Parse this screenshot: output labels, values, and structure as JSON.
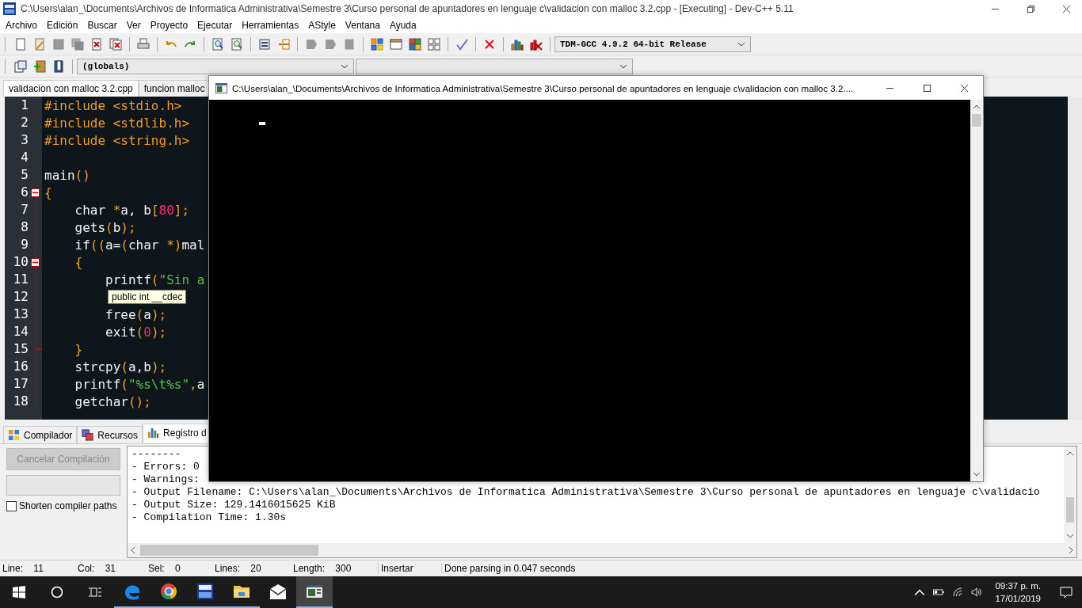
{
  "window": {
    "title": "C:\\Users\\alan_\\Documents\\Archivos de Informatica Administrativa\\Semestre 3\\Curso personal de apuntadores en lenguaje c\\validacion con malloc 3.2.cpp - [Executing] - Dev-C++ 5.11"
  },
  "menu": [
    "Archivo",
    "Edición",
    "Buscar",
    "Ver",
    "Proyecto",
    "Ejecutar",
    "Herramientas",
    "AStyle",
    "Ventana",
    "Ayuda"
  ],
  "compiler": {
    "value": "TDM-GCC 4.9.2 64-bit Release"
  },
  "scope": {
    "value": "(globals)"
  },
  "editor_tabs": [
    {
      "label": "validacion con malloc 3.2.cpp",
      "selected": true
    },
    {
      "label": "funcion malloc",
      "selected": false
    }
  ],
  "code": [
    {
      "n": "1",
      "kind": "plain",
      "tokens": [
        {
          "kind": "pre",
          "t": "#include <stdio.h>"
        }
      ]
    },
    {
      "n": "2",
      "kind": "plain",
      "tokens": [
        {
          "kind": "pre",
          "t": "#include <stdlib.h>"
        }
      ]
    },
    {
      "n": "3",
      "kind": "plain",
      "tokens": [
        {
          "kind": "pre",
          "t": "#include <string.h>"
        }
      ]
    },
    {
      "n": "4",
      "kind": "plain"
    },
    {
      "n": "5",
      "kind": "plain",
      "tokens": [
        {
          "kind": "id",
          "t": "main"
        },
        {
          "kind": "sym",
          "t": "()"
        }
      ]
    },
    {
      "n": "6",
      "kind": "fold_start",
      "tokens": [
        {
          "kind": "sym",
          "t": "{"
        }
      ]
    },
    {
      "n": "7",
      "kind": "plain",
      "tokens": [
        {
          "kind": "id",
          "t": "    char "
        },
        {
          "kind": "sym",
          "t": "*"
        },
        {
          "kind": "id",
          "t": "a, b"
        },
        {
          "kind": "sym",
          "t": "["
        },
        {
          "kind": "num",
          "t": "80"
        },
        {
          "kind": "sym",
          "t": "];"
        }
      ]
    },
    {
      "n": "8",
      "kind": "plain",
      "tokens": [
        {
          "kind": "id",
          "t": "    gets"
        },
        {
          "kind": "sym",
          "t": "("
        },
        {
          "kind": "id",
          "t": "b"
        },
        {
          "kind": "sym",
          "t": ");"
        }
      ]
    },
    {
      "n": "9",
      "kind": "plain",
      "tokens": [
        {
          "kind": "id",
          "t": "    if"
        },
        {
          "kind": "sym",
          "t": "(("
        },
        {
          "kind": "id",
          "t": "a="
        },
        {
          "kind": "sym",
          "t": "("
        },
        {
          "kind": "id",
          "t": "char "
        },
        {
          "kind": "sym",
          "t": "*)"
        },
        {
          "kind": "id",
          "t": "mal"
        }
      ]
    },
    {
      "n": "10",
      "kind": "fold_start",
      "tokens": [
        {
          "kind": "sym",
          "t": "    {"
        }
      ]
    },
    {
      "n": "11",
      "kind": "plain",
      "tokens": [
        {
          "kind": "id",
          "t": "        printf"
        },
        {
          "kind": "sym",
          "t": "("
        },
        {
          "kind": "str",
          "t": "\"Sin a"
        }
      ]
    },
    {
      "n": "12",
      "kind": "plain"
    },
    {
      "n": "13",
      "kind": "plain",
      "tokens": [
        {
          "kind": "id",
          "t": "        free"
        },
        {
          "kind": "sym",
          "t": "("
        },
        {
          "kind": "id",
          "t": "a"
        },
        {
          "kind": "sym",
          "t": ");"
        }
      ]
    },
    {
      "n": "14",
      "kind": "plain",
      "tokens": [
        {
          "kind": "id",
          "t": "        exit"
        },
        {
          "kind": "sym",
          "t": "("
        },
        {
          "kind": "num",
          "t": "0"
        },
        {
          "kind": "sym",
          "t": ");"
        }
      ]
    },
    {
      "n": "15",
      "kind": "fold_end",
      "tokens": [
        {
          "kind": "sym",
          "t": "    }"
        }
      ]
    },
    {
      "n": "16",
      "kind": "plain",
      "tokens": [
        {
          "kind": "id",
          "t": "    strcpy"
        },
        {
          "kind": "sym",
          "t": "("
        },
        {
          "kind": "id",
          "t": "a,b"
        },
        {
          "kind": "sym",
          "t": ");"
        }
      ]
    },
    {
      "n": "17",
      "kind": "plain",
      "tokens": [
        {
          "kind": "id",
          "t": "    printf"
        },
        {
          "kind": "sym",
          "t": "("
        },
        {
          "kind": "str",
          "t": "\"%s\\t%s\""
        },
        {
          "kind": "sym",
          "t": ","
        },
        {
          "kind": "id",
          "t": "a"
        }
      ]
    },
    {
      "n": "18",
      "kind": "plain",
      "tokens": [
        {
          "kind": "id",
          "t": "    getchar"
        },
        {
          "kind": "sym",
          "t": "();"
        }
      ]
    }
  ],
  "tooltip": "public int __cdec",
  "console": {
    "title": "C:\\Users\\alan_\\Documents\\Archivos de Informatica Administrativa\\Semestre 3\\Curso personal de apuntadores en lenguaje c\\validacion con malloc 3.2...."
  },
  "bottom_tabs": [
    {
      "label": "Compilador",
      "selected": false
    },
    {
      "label": "Recursos",
      "selected": false
    },
    {
      "label": "Registro d",
      "selected": true
    }
  ],
  "cancel_button": {
    "label": "Cancelar Compilación",
    "disabled": true
  },
  "progress": {
    "level": 0
  },
  "shorten_paths": {
    "label": "Shorten compiler paths",
    "checked": false
  },
  "log": [
    "--------",
    "- Errors: 0",
    "- Warnings:",
    "- Output Filename: C:\\Users\\alan_\\Documents\\Archivos de Informatica Administrativa\\Semestre 3\\Curso personal de apuntadores en lenguaje c\\validacio",
    "- Output Size: 129.1416015625 KiB",
    "- Compilation Time: 1.30s"
  ],
  "status_bar": [
    {
      "label": "Line:",
      "value": "11"
    },
    {
      "label": "Col:",
      "value": "31"
    },
    {
      "label": "Sel:",
      "value": "0"
    },
    {
      "label": "Lines:",
      "value": "20"
    },
    {
      "label": "Length:",
      "value": "300"
    }
  ],
  "mode": "Insertar",
  "message": "Done parsing in 0.047 seconds",
  "taskbar": {
    "apps": [
      {
        "running": true,
        "selected": false
      },
      {
        "running": true,
        "selected": false
      },
      {
        "running": true,
        "selected": false
      },
      {
        "running": true,
        "selected": false
      },
      {
        "running": false,
        "selected": false
      },
      {
        "running": true,
        "selected": true
      }
    ],
    "time": "09:37 p. m.",
    "date": "17/01/2019"
  }
}
